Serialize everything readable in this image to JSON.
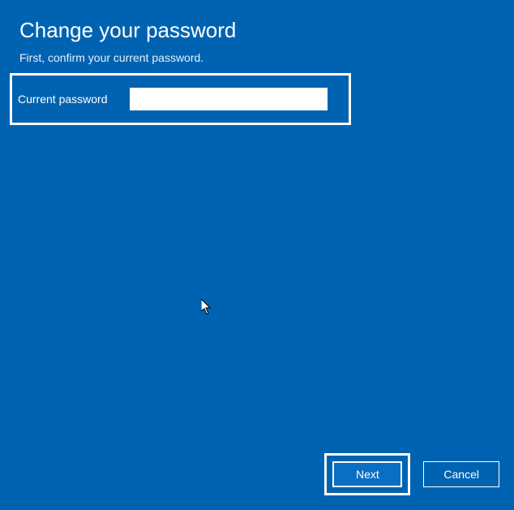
{
  "header": {
    "title": "Change your password",
    "subtitle": "First, confirm your current password."
  },
  "form": {
    "current_password_label": "Current password",
    "current_password_value": ""
  },
  "buttons": {
    "next": "Next",
    "cancel": "Cancel"
  }
}
